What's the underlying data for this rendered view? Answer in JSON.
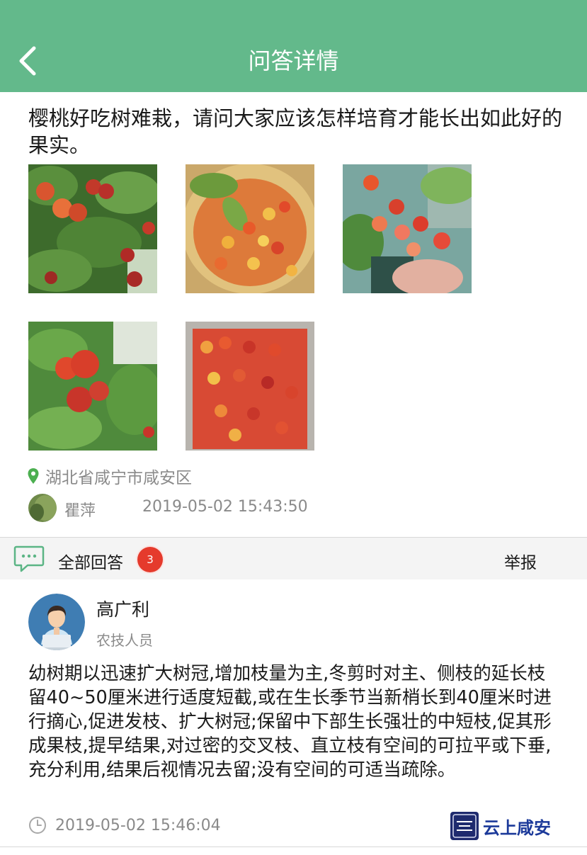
{
  "header": {
    "title": "问答详情"
  },
  "question": {
    "text": "樱桃好吃树难栽，请问大家应该怎样培育才能长出如此好的果实。",
    "location": "湖北省咸宁市咸安区",
    "asker": "瞿萍",
    "time": "2019-05-02 15:43:50"
  },
  "answers_bar": {
    "label": "全部回答",
    "count": "3",
    "report": "举报"
  },
  "answer": {
    "name": "高广利",
    "role": "农技人员",
    "text": "幼树期以迅速扩大树冠,增加枝量为主,冬剪时对主、侧枝的延长枝留40~50厘米进行适度短截,或在生长季节当新梢长到40厘米时进行摘心,促进发枝、扩大树冠;保留中下部生长强壮的中短枝,促其形成果枝,提早结果,对过密的交叉枝、直立枝有空间的可拉平或下垂,充分利用,结果后视情况去留;没有空间的可适当疏除。",
    "time": "2019-05-02 15:46:04"
  },
  "watermark": {
    "text": "云上咸安"
  },
  "colors": {
    "header": "#63b98b",
    "badge": "#e53a2c",
    "pin": "#4caf50",
    "watermark": "#1c3a9a"
  },
  "icons": [
    "chevron-left-icon",
    "location-pin-icon",
    "chat-bubble-icon",
    "clock-icon"
  ]
}
